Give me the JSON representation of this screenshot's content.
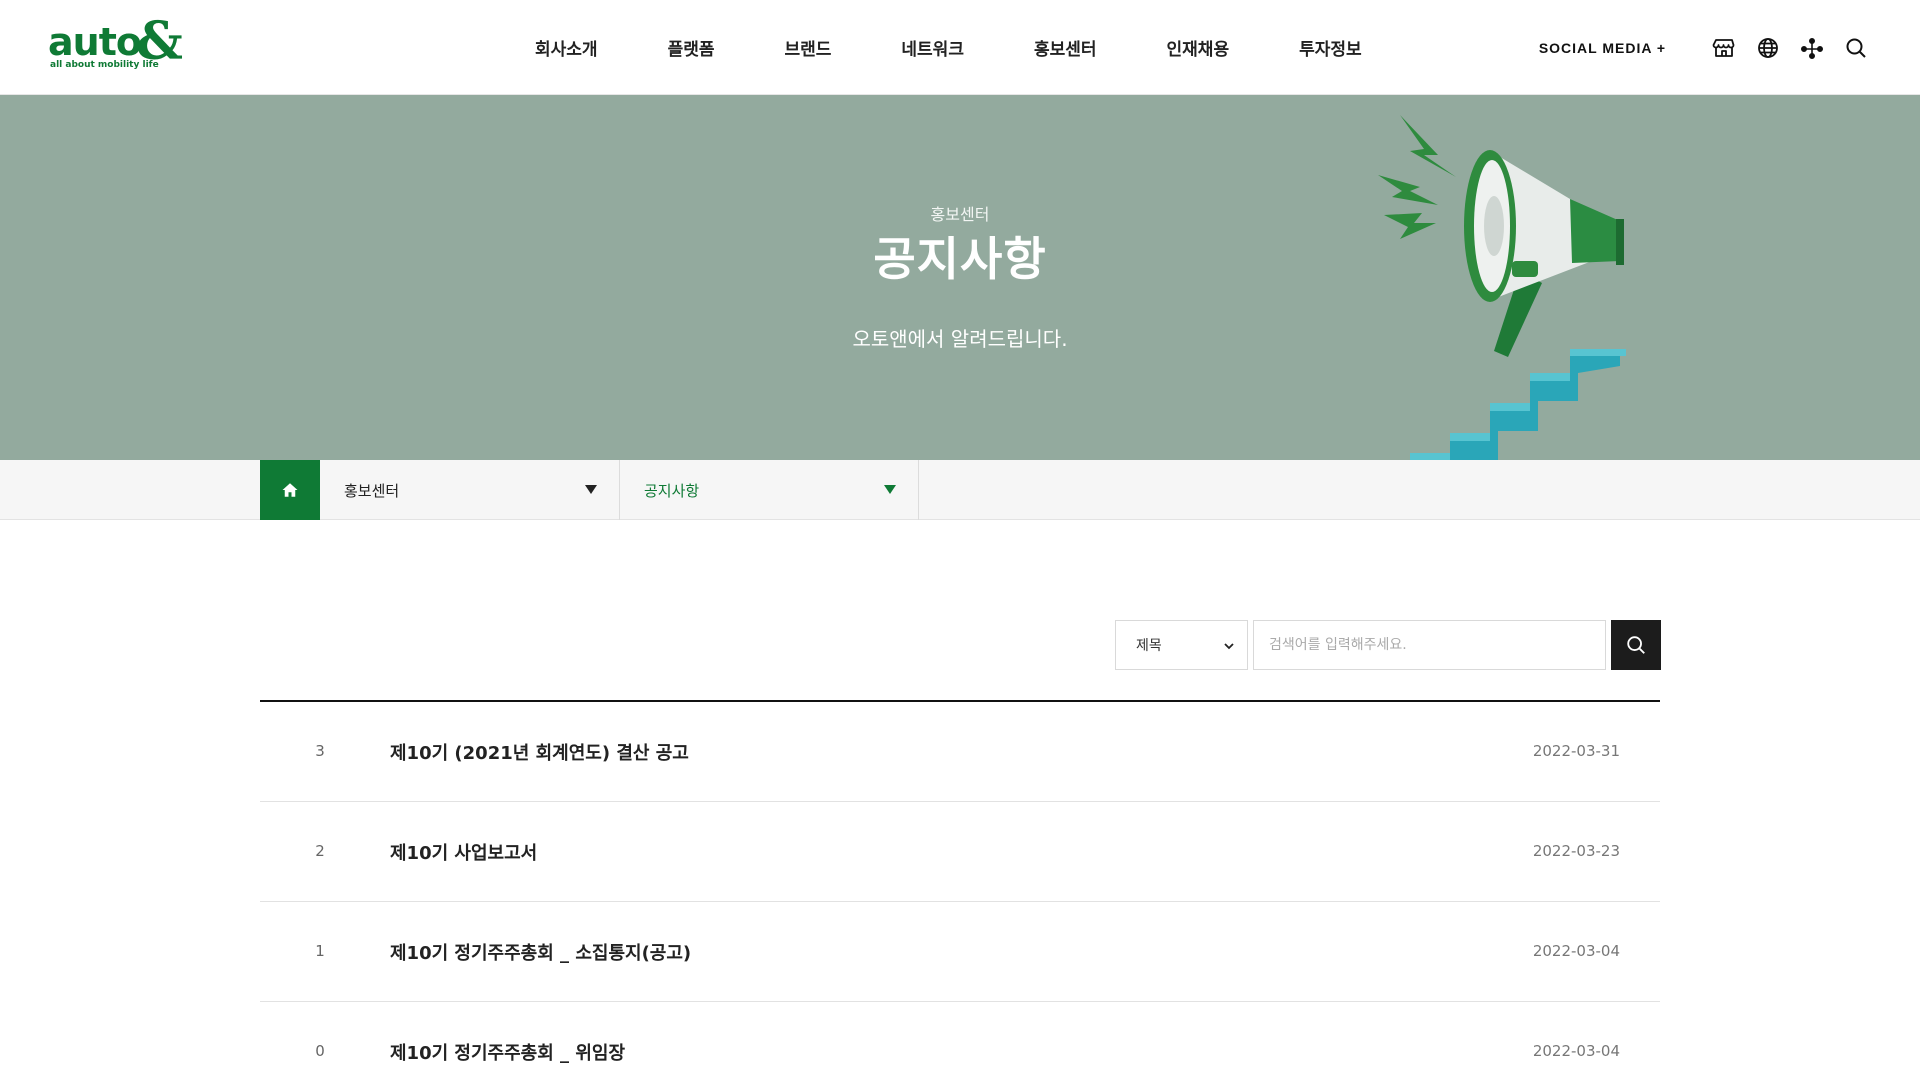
{
  "logo": {
    "word": "auto",
    "amp": "&",
    "tagline": "all about mobility life"
  },
  "nav": {
    "items": [
      "회사소개",
      "플랫폼",
      "브랜드",
      "네트워크",
      "홍보센터",
      "인재채용",
      "투자정보"
    ]
  },
  "utility": {
    "social_label": "SOCIAL MEDIA +",
    "icons": [
      "store-icon",
      "globe-icon",
      "share-icon",
      "search-icon"
    ]
  },
  "hero": {
    "subtitle": "홍보센터",
    "title": "공지사항",
    "description": "오토앤에서 알려드립니다."
  },
  "location": {
    "home_icon": "home-icon",
    "section": "홍보센터",
    "page": "공지사항"
  },
  "search": {
    "field_selected": "제목",
    "placeholder": "검색어를 입력해주세요.",
    "button_icon": "search-icon"
  },
  "notices": [
    {
      "num": "3",
      "title": "제10기 (2021년 회계연도) 결산 공고",
      "date": "2022-03-31"
    },
    {
      "num": "2",
      "title": "제10기 사업보고서",
      "date": "2022-03-23"
    },
    {
      "num": "1",
      "title": "제10기 정기주주총회 _ 소집통지(공고)",
      "date": "2022-03-04"
    },
    {
      "num": "0",
      "title": "제10기 정기주주총회 _ 위임장",
      "date": "2022-03-04"
    }
  ],
  "colors": {
    "brand_green": "#0f7a35",
    "hero_bg": "#93aa9e",
    "search_button": "#1c1c1c"
  }
}
